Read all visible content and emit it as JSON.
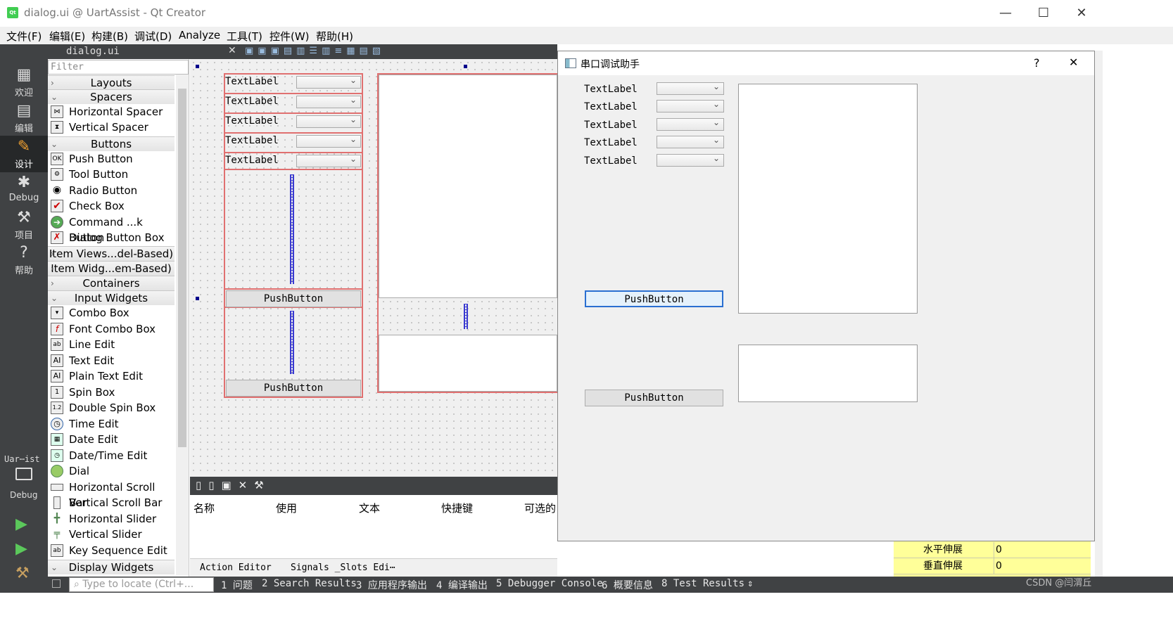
{
  "window": {
    "title": "dialog.ui @ UartAssist - Qt Creator",
    "app_icon": "Qt"
  },
  "menu": [
    "文件(F)",
    "编辑(E)",
    "构建(B)",
    "调试(D)",
    "Analyze",
    "工具(T)",
    "控件(W)",
    "帮助(H)"
  ],
  "modes": [
    {
      "label": "欢迎",
      "icon": "grid-icon"
    },
    {
      "label": "编辑",
      "icon": "edit-icon"
    },
    {
      "label": "设计",
      "icon": "pencil-icon"
    },
    {
      "label": "Debug",
      "icon": "bug-icon"
    },
    {
      "label": "项目",
      "icon": "wrench-icon"
    },
    {
      "label": "帮助",
      "icon": "help-icon"
    }
  ],
  "kit": {
    "project": "Uar⋯ist",
    "config": "Debug"
  },
  "doc_tab": {
    "filename": "dialog.ui"
  },
  "widget_box": {
    "filter_placeholder": "Filter",
    "categories": {
      "layouts": "Layouts",
      "spacers": "Spacers",
      "buttons": "Buttons",
      "item_views": "Item Views...del-Based)",
      "item_widgets": "Item Widg...em-Based)",
      "containers": "Containers",
      "input_widgets": "Input Widgets",
      "display_widgets": "Display Widgets"
    },
    "spacers": [
      "Horizontal Spacer",
      "Vertical Spacer"
    ],
    "buttons": [
      "Push Button",
      "Tool Button",
      "Radio Button",
      "Check Box",
      "Command ...k Button",
      "Dialog Button Box"
    ],
    "input_widgets": [
      "Combo Box",
      "Font Combo Box",
      "Line Edit",
      "Text Edit",
      "Plain Text Edit",
      "Spin Box",
      "Double Spin Box",
      "Time Edit",
      "Date Edit",
      "Date/Time Edit",
      "Dial",
      "Horizontal Scroll Bar",
      "Vertical Scroll Bar",
      "Horizontal Slider",
      "Vertical Slider",
      "Key Sequence Edit"
    ]
  },
  "form": {
    "labels": [
      "TextLabel",
      "TextLabel",
      "TextLabel",
      "TextLabel",
      "TextLabel"
    ],
    "button1": "PushButton",
    "button2": "PushButton"
  },
  "action_editor": {
    "columns": [
      "名称",
      "使用",
      "文本",
      "快捷键",
      "可选的"
    ],
    "tabs": [
      "Action Editor",
      "Signals _Slots Edi⋯"
    ]
  },
  "preview": {
    "title": "串口调试助手",
    "help": "?",
    "close": "✕",
    "labels": [
      "TextLabel",
      "TextLabel",
      "TextLabel",
      "TextLabel",
      "TextLabel"
    ],
    "button1": "PushButton",
    "button2": "PushButton"
  },
  "properties": [
    {
      "name": "水平伸展",
      "value": "0"
    },
    {
      "name": "垂直伸展",
      "value": "0"
    }
  ],
  "statusbar": {
    "locate_placeholder": "Type to locate (Ctrl+...",
    "tabs": [
      "1 问题",
      "2 Search Results",
      "3 应用程序输出",
      "4 编译输出",
      "5 Debugger Console",
      "6 概要信息",
      "8 Test Results"
    ]
  },
  "watermark": "CSDN @闫渭丘",
  "colors": {
    "sidebar": "#404244",
    "selection_border": "#e07070",
    "spacer": "#3a3ad0",
    "props_bg": "#ffff99"
  }
}
